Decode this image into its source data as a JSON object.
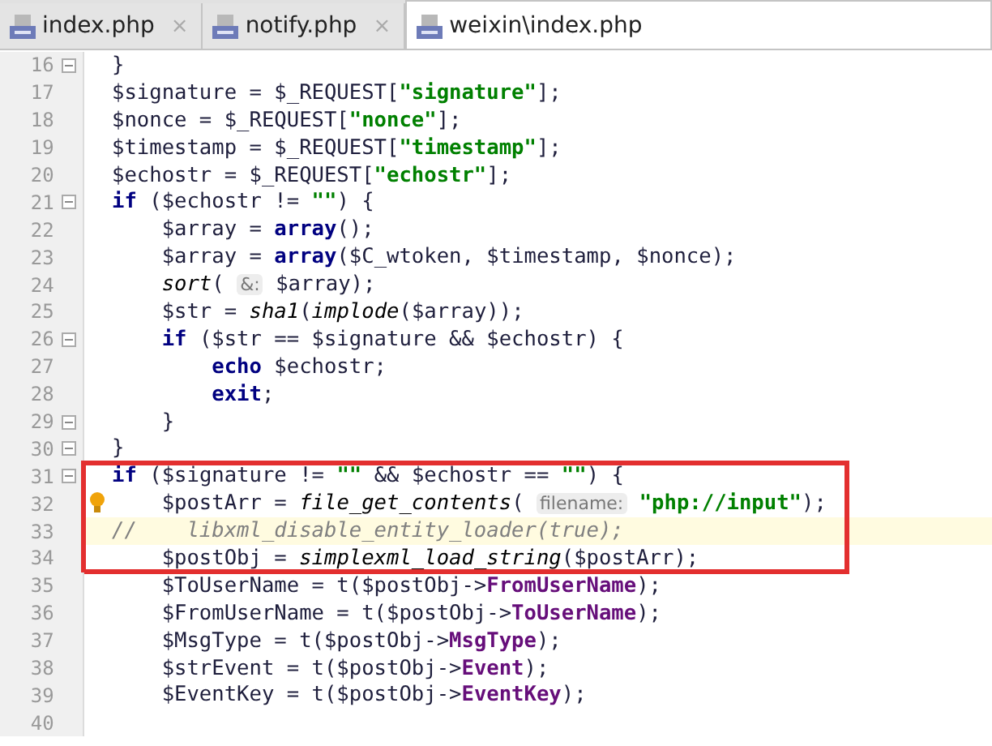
{
  "tabs": [
    {
      "label": "index.php",
      "close": "×",
      "selected": false
    },
    {
      "label": "notify.php",
      "close": "×",
      "selected": false
    },
    {
      "label": "weixin\\index.php",
      "selected": true
    }
  ],
  "editor": {
    "lines": [
      {
        "number": "16",
        "fold": true,
        "current": false,
        "boxed": false,
        "tokens": [
          {
            "kind": "plain",
            "text": "}"
          }
        ]
      },
      {
        "number": "17",
        "fold": false,
        "current": false,
        "boxed": false,
        "tokens": [
          {
            "kind": "plain",
            "text": "$signature = $_REQUEST["
          },
          {
            "kind": "str",
            "text": "\"signature\""
          },
          {
            "kind": "plain",
            "text": "];"
          }
        ]
      },
      {
        "number": "18",
        "fold": false,
        "current": false,
        "boxed": false,
        "tokens": [
          {
            "kind": "plain",
            "text": "$nonce = $_REQUEST["
          },
          {
            "kind": "str",
            "text": "\"nonce\""
          },
          {
            "kind": "plain",
            "text": "];"
          }
        ]
      },
      {
        "number": "19",
        "fold": false,
        "current": false,
        "boxed": false,
        "tokens": [
          {
            "kind": "plain",
            "text": "$timestamp = $_REQUEST["
          },
          {
            "kind": "str",
            "text": "\"timestamp\""
          },
          {
            "kind": "plain",
            "text": "];"
          }
        ]
      },
      {
        "number": "20",
        "fold": false,
        "current": false,
        "boxed": false,
        "tokens": [
          {
            "kind": "plain",
            "text": "$echostr = $_REQUEST["
          },
          {
            "kind": "str",
            "text": "\"echostr\""
          },
          {
            "kind": "plain",
            "text": "];"
          }
        ]
      },
      {
        "number": "21",
        "fold": true,
        "current": false,
        "boxed": false,
        "tokens": [
          {
            "kind": "kw",
            "text": "if"
          },
          {
            "kind": "plain",
            "text": " ($echostr != "
          },
          {
            "kind": "str",
            "text": "\"\""
          },
          {
            "kind": "plain",
            "text": ") {"
          }
        ]
      },
      {
        "number": "22",
        "fold": false,
        "current": false,
        "boxed": false,
        "tokens": [
          {
            "kind": "plain",
            "text": "    $array = "
          },
          {
            "kind": "kw",
            "text": "array"
          },
          {
            "kind": "plain",
            "text": "();"
          }
        ]
      },
      {
        "number": "23",
        "fold": false,
        "current": false,
        "boxed": false,
        "tokens": [
          {
            "kind": "plain",
            "text": "    $array = "
          },
          {
            "kind": "kw",
            "text": "array"
          },
          {
            "kind": "plain",
            "text": "($C_wtoken, $timestamp, $nonce);"
          }
        ]
      },
      {
        "number": "24",
        "fold": false,
        "current": false,
        "boxed": false,
        "tokens": [
          {
            "kind": "fn",
            "text": "    sort"
          },
          {
            "kind": "plain",
            "text": "( "
          },
          {
            "kind": "hint",
            "text": "&:"
          },
          {
            "kind": "plain",
            "text": " $array);"
          }
        ]
      },
      {
        "number": "25",
        "fold": false,
        "current": false,
        "boxed": false,
        "tokens": [
          {
            "kind": "plain",
            "text": "    $str = "
          },
          {
            "kind": "fn",
            "text": "sha1"
          },
          {
            "kind": "plain",
            "text": "("
          },
          {
            "kind": "fn",
            "text": "implode"
          },
          {
            "kind": "plain",
            "text": "($array));"
          }
        ]
      },
      {
        "number": "26",
        "fold": true,
        "current": false,
        "boxed": false,
        "tokens": [
          {
            "kind": "kw",
            "text": "    if"
          },
          {
            "kind": "plain",
            "text": " ($str == $signature && $echostr) {"
          }
        ]
      },
      {
        "number": "27",
        "fold": false,
        "current": false,
        "boxed": false,
        "tokens": [
          {
            "kind": "kw",
            "text": "        echo"
          },
          {
            "kind": "plain",
            "text": " $echostr;"
          }
        ]
      },
      {
        "number": "28",
        "fold": false,
        "current": false,
        "boxed": false,
        "tokens": [
          {
            "kind": "kw",
            "text": "        exit"
          },
          {
            "kind": "plain",
            "text": ";"
          }
        ]
      },
      {
        "number": "29",
        "fold": true,
        "current": false,
        "boxed": false,
        "tokens": [
          {
            "kind": "plain",
            "text": "    }"
          }
        ]
      },
      {
        "number": "30",
        "fold": true,
        "current": false,
        "boxed": false,
        "tokens": [
          {
            "kind": "plain",
            "text": "}"
          }
        ]
      },
      {
        "number": "31",
        "fold": true,
        "current": false,
        "boxed": true,
        "tokens": [
          {
            "kind": "kw",
            "text": "if"
          },
          {
            "kind": "plain",
            "text": " ($signature != "
          },
          {
            "kind": "str",
            "text": "\"\""
          },
          {
            "kind": "plain",
            "text": " && $echostr == "
          },
          {
            "kind": "str",
            "text": "\"\""
          },
          {
            "kind": "plain",
            "text": ") {"
          }
        ]
      },
      {
        "number": "32",
        "fold": false,
        "current": false,
        "boxed": true,
        "bulb": true,
        "tokens": [
          {
            "kind": "plain",
            "text": "    $postArr = "
          },
          {
            "kind": "fn",
            "text": "file_get_contents"
          },
          {
            "kind": "plain",
            "text": "( "
          },
          {
            "kind": "hint",
            "text": "filename:"
          },
          {
            "kind": "str",
            "text": " \"php://input\""
          },
          {
            "kind": "plain",
            "text": ");"
          }
        ]
      },
      {
        "number": "33",
        "fold": false,
        "current": true,
        "boxed": true,
        "tokens": [
          {
            "kind": "comment",
            "text": "//    libxml_disable_entity_loader(true);"
          }
        ]
      },
      {
        "number": "34",
        "fold": false,
        "current": false,
        "boxed": true,
        "tokens": [
          {
            "kind": "plain",
            "text": "    $postObj = "
          },
          {
            "kind": "fn",
            "text": "simplexml_load_string"
          },
          {
            "kind": "plain",
            "text": "($postArr);"
          }
        ]
      },
      {
        "number": "35",
        "fold": false,
        "current": false,
        "boxed": false,
        "tokens": [
          {
            "kind": "plain",
            "text": "    $ToUserName = t($postObj->"
          },
          {
            "kind": "prop",
            "text": "FromUserName"
          },
          {
            "kind": "plain",
            "text": ");"
          }
        ]
      },
      {
        "number": "36",
        "fold": false,
        "current": false,
        "boxed": false,
        "tokens": [
          {
            "kind": "plain",
            "text": "    $FromUserName = t($postObj->"
          },
          {
            "kind": "prop",
            "text": "ToUserName"
          },
          {
            "kind": "plain",
            "text": ");"
          }
        ]
      },
      {
        "number": "37",
        "fold": false,
        "current": false,
        "boxed": false,
        "tokens": [
          {
            "kind": "plain",
            "text": "    $MsgType = t($postObj->"
          },
          {
            "kind": "prop",
            "text": "MsgType"
          },
          {
            "kind": "plain",
            "text": ");"
          }
        ]
      },
      {
        "number": "38",
        "fold": false,
        "current": false,
        "boxed": false,
        "tokens": [
          {
            "kind": "plain",
            "text": "    $strEvent = t($postObj->"
          },
          {
            "kind": "prop",
            "text": "Event"
          },
          {
            "kind": "plain",
            "text": ");"
          }
        ]
      },
      {
        "number": "39",
        "fold": false,
        "current": false,
        "boxed": false,
        "tokens": [
          {
            "kind": "plain",
            "text": "    $EventKey = t($postObj->"
          },
          {
            "kind": "prop",
            "text": "EventKey"
          },
          {
            "kind": "plain",
            "text": ");"
          }
        ]
      },
      {
        "number": "40",
        "fold": false,
        "current": false,
        "boxed": false
      }
    ]
  }
}
